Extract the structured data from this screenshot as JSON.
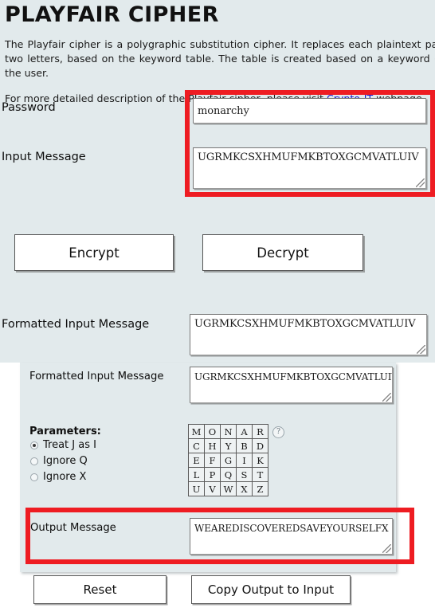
{
  "header": {
    "title": "PLAYFAIR CIPHER",
    "intro_paragraph": "The Playfair cipher is a polygraphic substitution cipher. It replaces each plaintext pair of letters by another two letters, based on the keyword table. The table is created based on a keyword (password) provided by the user.",
    "intro_paragraph2_prefix": "For more detailed description of the Playfair cipher, please visit ",
    "intro_link": "Crypto-IT",
    "intro_paragraph2_suffix": " webpage."
  },
  "form": {
    "password_label": "Password",
    "password_value": "monarchy",
    "input_message_label": "Input Message",
    "input_message_value": "UGRMKCSXHMUFMKBTOXGCMVATLUIV",
    "encrypt_label": "Encrypt",
    "decrypt_label": "Decrypt",
    "formatted_input_label": "Formatted Input Message",
    "formatted_input_value": "UGRMKCSXHMUFMKBTOXGCMVATLUIV"
  },
  "inner_panel": {
    "formatted_input_label": "Formatted Input Message",
    "formatted_input_value": "UGRMKCSXHMUFMKBTOXGCMVATLUIV",
    "parameters_label": "Parameters:",
    "options": [
      {
        "label": "Treat J as I",
        "selected": true
      },
      {
        "label": "Ignore Q",
        "selected": false
      },
      {
        "label": "Ignore X",
        "selected": false
      }
    ],
    "help_icon_glyph": "?",
    "key_table": [
      [
        "M",
        "O",
        "N",
        "A",
        "R"
      ],
      [
        "C",
        "H",
        "Y",
        "B",
        "D"
      ],
      [
        "E",
        "F",
        "G",
        "I",
        "K"
      ],
      [
        "L",
        "P",
        "Q",
        "S",
        "T"
      ],
      [
        "U",
        "V",
        "W",
        "X",
        "Z"
      ]
    ],
    "output_label": "Output Message",
    "output_value": "WEAREDISCOVEREDSAVEYOURSELFX",
    "reset_label": "Reset",
    "copy_label": "Copy Output to Input"
  },
  "colors": {
    "page_background": "#e2eaec",
    "highlight": "#ee1c22",
    "link": "#1515cc"
  }
}
